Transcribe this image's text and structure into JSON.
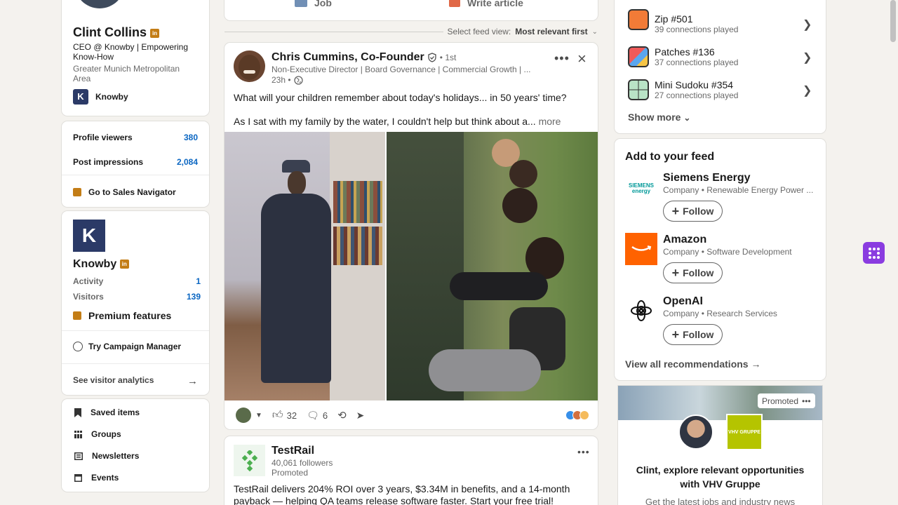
{
  "profile": {
    "name": "Clint Collins",
    "headline": "CEO @ Knowby | Empowering Know-How",
    "location": "Greater Munich Metropolitan Area",
    "company": "Knowby",
    "in_badge": "in"
  },
  "stats": {
    "viewers_label": "Profile viewers",
    "viewers_value": "380",
    "impressions_label": "Post impressions",
    "impressions_value": "2,084",
    "sales_nav": "Go to Sales Navigator"
  },
  "page_card": {
    "name": "Knowby",
    "activity_label": "Activity",
    "activity_value": "1",
    "visitors_label": "Visitors",
    "visitors_value": "139",
    "premium": "Premium features",
    "campaign": "Try Campaign Manager",
    "analytics": "See visitor analytics"
  },
  "shortcuts": {
    "items": [
      "Saved items",
      "Groups",
      "Newsletters",
      "Events"
    ]
  },
  "composer": {
    "job": "Job",
    "write_article": "Write article"
  },
  "feed_sort": {
    "label": "Select feed view:",
    "value": "Most relevant first"
  },
  "post1": {
    "author": "Chris Cummins, Co-Founder",
    "degree": "• 1st",
    "subtitle": "Non-Executive Director | Board Governance | Commercial Growth | ...",
    "time": "23h •",
    "line1": "What will your children remember about today's holidays... in 50 years' time?",
    "line2": "As I sat with my family by the water, I couldn't help but think about a...",
    "more": "more",
    "likes": "32",
    "comments": "6"
  },
  "post2": {
    "author": "TestRail",
    "followers": "40,061 followers",
    "promoted": "Promoted",
    "body": "TestRail delivers 204% ROI over 3 years, $3.34M in benefits, and a 14-month payback — helping QA teams release software faster. Start your free trial!"
  },
  "games": {
    "items": [
      {
        "name": "Zip #501",
        "sub": "39 connections played"
      },
      {
        "name": "Patches #136",
        "sub": "37 connections played"
      },
      {
        "name": "Mini Sudoku #354",
        "sub": "27 connections played"
      }
    ],
    "show_more": "Show more"
  },
  "recommendations": {
    "title": "Add to your feed",
    "items": [
      {
        "name": "Siemens Energy",
        "sub": "Company • Renewable Energy Power ...",
        "logo_text": "SIEMENS energy"
      },
      {
        "name": "Amazon",
        "sub": "Company • Software Development"
      },
      {
        "name": "OpenAI",
        "sub": "Company • Research Services"
      }
    ],
    "follow": "Follow",
    "view_all": "View all recommendations →"
  },
  "ad": {
    "badge": "Promoted",
    "brand_text": "VHV GRUPPE",
    "headline": "Clint, explore relevant opportunities with VHV Gruppe",
    "sub": "Get the latest jobs and industry news"
  },
  "colors": {
    "accent": "#0a66c2",
    "premium": "#c37d16",
    "amazon": "#ff6200",
    "vhv": "#b5c400"
  }
}
